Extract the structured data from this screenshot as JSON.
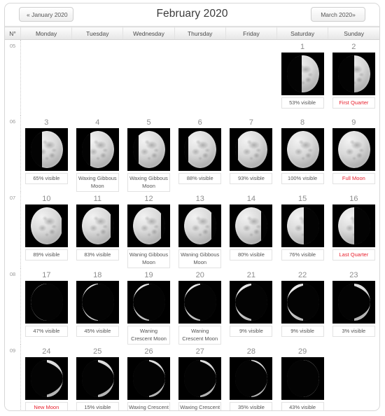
{
  "nav": {
    "prev_label": "« January 2020",
    "next_label": "March 2020»",
    "title": "February 2020"
  },
  "table": {
    "week_col_header": "N°",
    "day_headers": [
      "Monday",
      "Tuesday",
      "Wednesday",
      "Thursday",
      "Friday",
      "Saturday",
      "Sunday"
    ]
  },
  "colors": {
    "event_text": "#e8212e",
    "daynum_text": "#8d8d8d",
    "caption_text": "#555555",
    "header_bg": "#f0f0f0",
    "border": "#d7d7d7",
    "moon_dark": "#000000"
  },
  "weeks": [
    {
      "number": "05",
      "days": [
        {
          "num": "",
          "caption": "",
          "empty": true
        },
        {
          "num": "",
          "caption": "",
          "empty": true
        },
        {
          "num": "",
          "caption": "",
          "empty": true
        },
        {
          "num": "",
          "caption": "",
          "empty": true
        },
        {
          "num": "",
          "caption": "",
          "empty": true
        },
        {
          "num": "1",
          "caption": "53% visible",
          "event": false,
          "illum": 53,
          "dir": "waxing"
        },
        {
          "num": "2",
          "caption": "First Quarter",
          "event": true,
          "illum": 50,
          "dir": "waxing"
        }
      ]
    },
    {
      "number": "06",
      "days": [
        {
          "num": "3",
          "caption": "65% visible",
          "event": false,
          "illum": 65,
          "dir": "waxing"
        },
        {
          "num": "4",
          "caption": "Waxing Gibbous Moon",
          "event": false,
          "illum": 74,
          "dir": "waxing"
        },
        {
          "num": "5",
          "caption": "Waxing Gibbous Moon",
          "event": false,
          "illum": 82,
          "dir": "waxing"
        },
        {
          "num": "6",
          "caption": "88% visible",
          "event": false,
          "illum": 88,
          "dir": "waxing"
        },
        {
          "num": "7",
          "caption": "93% visible",
          "event": false,
          "illum": 93,
          "dir": "waxing"
        },
        {
          "num": "8",
          "caption": "100% visible",
          "event": false,
          "illum": 100,
          "dir": "waxing"
        },
        {
          "num": "9",
          "caption": "Full Moon",
          "event": true,
          "illum": 100,
          "dir": "waxing"
        }
      ]
    },
    {
      "number": "07",
      "days": [
        {
          "num": "10",
          "caption": "89% visible",
          "event": false,
          "illum": 96,
          "dir": "waning"
        },
        {
          "num": "11",
          "caption": "83% visible",
          "event": false,
          "illum": 90,
          "dir": "waning"
        },
        {
          "num": "12",
          "caption": "Waning Gibbous Moon",
          "event": false,
          "illum": 86,
          "dir": "waning"
        },
        {
          "num": "13",
          "caption": "Waning Gibbous Moon",
          "event": false,
          "illum": 85,
          "dir": "waning"
        },
        {
          "num": "14",
          "caption": "80% visible",
          "event": false,
          "illum": 80,
          "dir": "waning"
        },
        {
          "num": "15",
          "caption": "76% visible",
          "event": false,
          "illum": 52,
          "dir": "waning"
        },
        {
          "num": "16",
          "caption": "Last Quarter",
          "event": true,
          "illum": 50,
          "dir": "waning"
        }
      ]
    },
    {
      "number": "08",
      "days": [
        {
          "num": "17",
          "caption": "47% visible",
          "event": false,
          "illum": 47,
          "dir": "waning"
        },
        {
          "num": "18",
          "caption": "45% visible",
          "event": false,
          "illum": 34,
          "dir": "waning"
        },
        {
          "num": "19",
          "caption": "Waning Crescent Moon",
          "event": false,
          "illum": 26,
          "dir": "waning"
        },
        {
          "num": "20",
          "caption": "Waning Crescent Moon",
          "event": false,
          "illum": 24,
          "dir": "waning"
        },
        {
          "num": "21",
          "caption": "9% visible",
          "event": false,
          "illum": 15,
          "dir": "waning"
        },
        {
          "num": "22",
          "caption": "9% visible",
          "event": false,
          "illum": 9,
          "dir": "waning"
        },
        {
          "num": "23",
          "caption": "3% visible",
          "event": false,
          "illum": 4,
          "dir": "waxing"
        }
      ]
    },
    {
      "number": "09",
      "days": [
        {
          "num": "24",
          "caption": "New Moon",
          "event": true,
          "illum": 3,
          "dir": "waxing"
        },
        {
          "num": "25",
          "caption": "15% visible",
          "event": false,
          "illum": 7,
          "dir": "waxing"
        },
        {
          "num": "26",
          "caption": "Waxing Crescent Moon",
          "event": false,
          "illum": 20,
          "dir": "waxing"
        },
        {
          "num": "27",
          "caption": "Waxing Crescent Moon",
          "event": false,
          "illum": 17,
          "dir": "waxing"
        },
        {
          "num": "28",
          "caption": "35% visible",
          "event": false,
          "illum": 30,
          "dir": "waxing"
        },
        {
          "num": "29",
          "caption": "43% visible",
          "event": false,
          "illum": 48,
          "dir": "waxing"
        },
        {
          "num": "",
          "caption": "",
          "empty": true
        }
      ]
    }
  ]
}
